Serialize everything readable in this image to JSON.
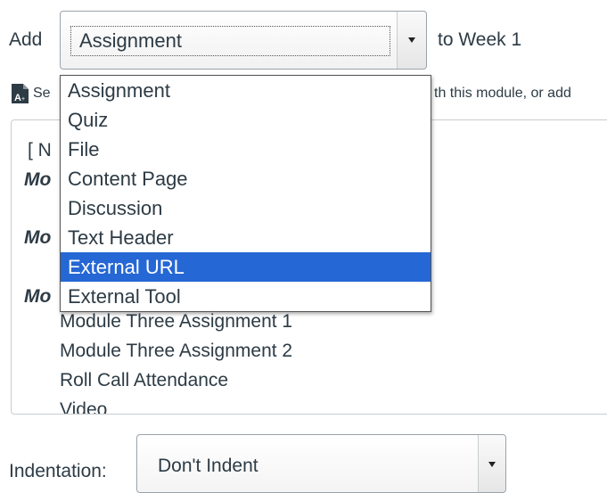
{
  "add_row": {
    "add_label": "Add",
    "selected_type": "Assignment",
    "to_label": "to Week 1"
  },
  "hint": {
    "left_fragment": "Se",
    "right_fragment": "th this module, or add"
  },
  "dropdown": {
    "options": [
      "Assignment",
      "Quiz",
      "File",
      "Content Page",
      "Discussion",
      "Text Header",
      "External URL",
      "External Tool"
    ],
    "highlighted": "External URL"
  },
  "panel": {
    "partial_rows": [
      "[ N",
      "Mo",
      "Mo",
      "Mo"
    ],
    "items": [
      "Module Three Assignment 1",
      "Module Three Assignment 2",
      "Roll Call Attendance",
      "Video"
    ]
  },
  "indentation": {
    "label": "Indentation:",
    "value": "Don't Indent"
  },
  "colors": {
    "highlight": "#2567d4",
    "text": "#2d3b45",
    "border": "#c7cdd1"
  }
}
